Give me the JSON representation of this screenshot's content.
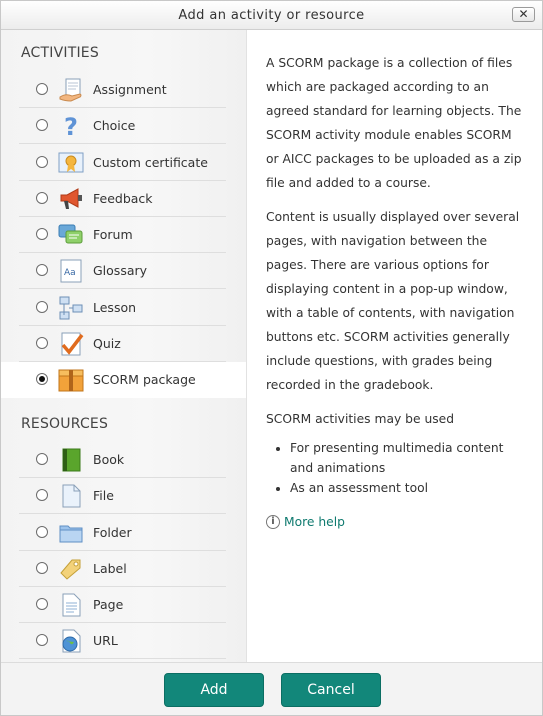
{
  "dialog": {
    "title": "Add an activity or resource",
    "close_label": "✕"
  },
  "activities": {
    "heading": "ACTIVITIES",
    "items": [
      {
        "label": "Assignment",
        "icon": "assignment-icon",
        "selected": false
      },
      {
        "label": "Choice",
        "icon": "choice-icon",
        "selected": false
      },
      {
        "label": "Custom certificate",
        "icon": "certificate-icon",
        "selected": false
      },
      {
        "label": "Feedback",
        "icon": "feedback-icon",
        "selected": false
      },
      {
        "label": "Forum",
        "icon": "forum-icon",
        "selected": false
      },
      {
        "label": "Glossary",
        "icon": "glossary-icon",
        "selected": false
      },
      {
        "label": "Lesson",
        "icon": "lesson-icon",
        "selected": false
      },
      {
        "label": "Quiz",
        "icon": "quiz-icon",
        "selected": false
      },
      {
        "label": "SCORM package",
        "icon": "scorm-icon",
        "selected": true
      }
    ]
  },
  "resources": {
    "heading": "RESOURCES",
    "items": [
      {
        "label": "Book",
        "icon": "book-icon",
        "selected": false
      },
      {
        "label": "File",
        "icon": "file-icon",
        "selected": false
      },
      {
        "label": "Folder",
        "icon": "folder-icon",
        "selected": false
      },
      {
        "label": "Label",
        "icon": "label-icon",
        "selected": false
      },
      {
        "label": "Page",
        "icon": "page-icon",
        "selected": false
      },
      {
        "label": "URL",
        "icon": "url-icon",
        "selected": false
      }
    ]
  },
  "help": {
    "para1": "A SCORM package is a collection of files which are packaged according to an agreed standard for learning objects. The SCORM activity module enables SCORM or AICC packages to be uploaded as a zip file and added to a course.",
    "para2": "Content is usually displayed over several pages, with navigation between the pages. There are various options for displaying content in a pop-up window, with a table of contents, with navigation buttons etc. SCORM activities generally include questions, with grades being recorded in the gradebook.",
    "para3": "SCORM activities may be used",
    "bullets": [
      "For presenting multimedia content and animations",
      "As an assessment tool"
    ],
    "more_help": "More help",
    "info_glyph": "i"
  },
  "footer": {
    "add_label": "Add",
    "cancel_label": "Cancel"
  },
  "colors": {
    "accent": "#12877a",
    "link": "#0f7a6f"
  }
}
